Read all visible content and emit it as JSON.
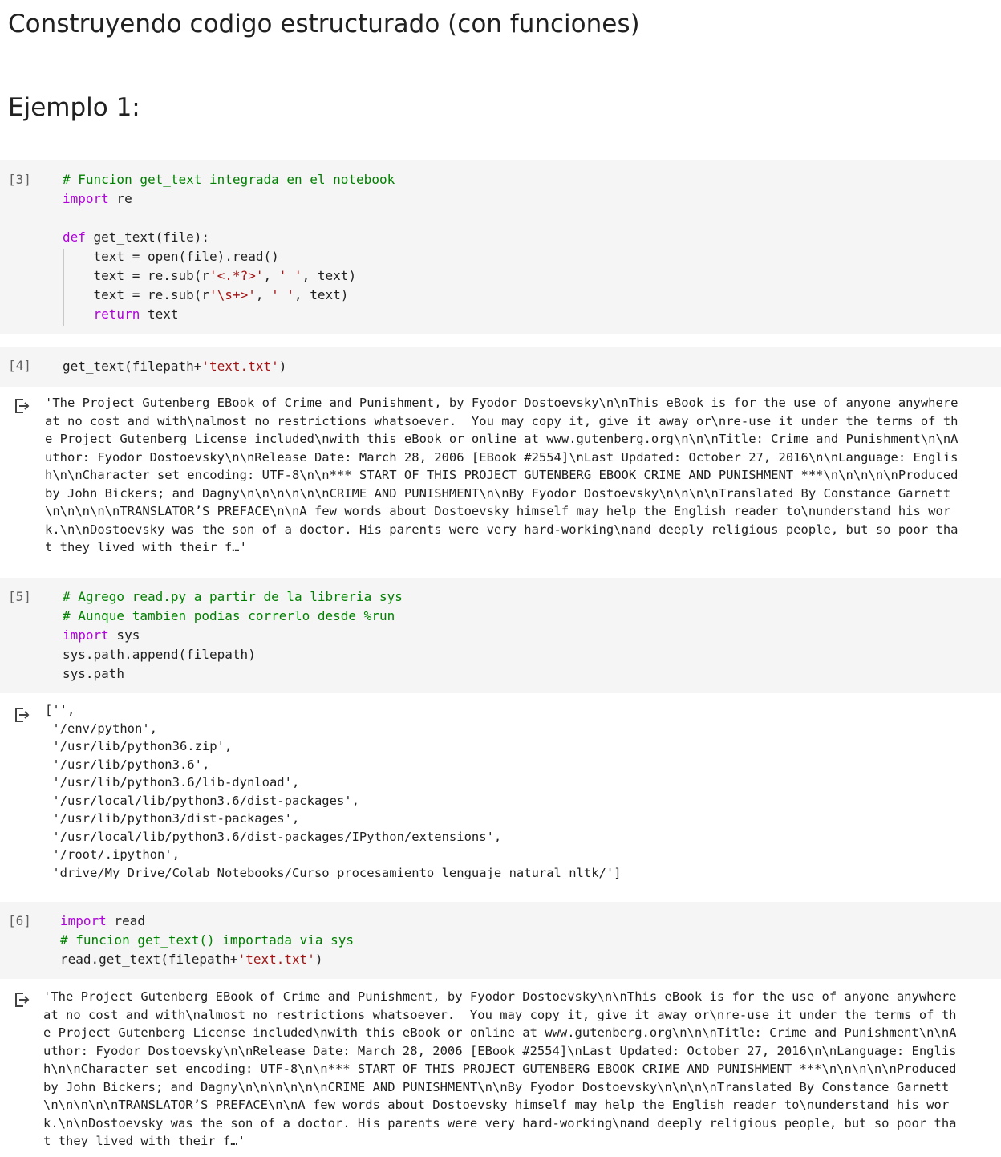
{
  "headings": {
    "title": "Construyendo codigo estructurado (con funciones)",
    "example": "Ejemplo 1:"
  },
  "cells": [
    {
      "exec_count": "[3]",
      "code_lines": [
        [
          {
            "t": "# Funcion get_text integrada en el notebook",
            "c": "cm"
          }
        ],
        [
          {
            "t": "import",
            "c": "kw"
          },
          {
            "t": " re",
            "c": ""
          }
        ],
        [
          {
            "t": "",
            "c": ""
          }
        ],
        [
          {
            "t": "def",
            "c": "kw"
          },
          {
            "t": " get_text(file):",
            "c": ""
          }
        ],
        [
          {
            "t": "    text = open(file).read()",
            "c": ""
          }
        ],
        [
          {
            "t": "    text = re.sub(r",
            "c": ""
          },
          {
            "t": "'<.*?>'",
            "c": "st"
          },
          {
            "t": ", ",
            "c": ""
          },
          {
            "t": "' '",
            "c": "st"
          },
          {
            "t": ", text)",
            "c": ""
          }
        ],
        [
          {
            "t": "    text = re.sub(r",
            "c": ""
          },
          {
            "t": "'\\s+>'",
            "c": "st"
          },
          {
            "t": ", ",
            "c": ""
          },
          {
            "t": "' '",
            "c": "st"
          },
          {
            "t": ", text)",
            "c": ""
          }
        ],
        [
          {
            "t": "    ",
            "c": ""
          },
          {
            "t": "return",
            "c": "kw"
          },
          {
            "t": " text",
            "c": ""
          }
        ]
      ]
    },
    {
      "exec_count": "[4]",
      "code_lines": [
        [
          {
            "t": "get_text(filepath+",
            "c": ""
          },
          {
            "t": "'text.txt'",
            "c": "st"
          },
          {
            "t": ")",
            "c": ""
          }
        ]
      ],
      "output_lines": [
        "'The Project Gutenberg EBook of Crime and Punishment, by Fyodor Dostoevsky\\n\\nThis eBook is for the use of anyone anywhere",
        "at no cost and with\\nalmost no restrictions whatsoever.  You may copy it, give it away or\\nre-use it under the terms of th",
        "e Project Gutenberg License included\\nwith this eBook or online at www.gutenberg.org\\n\\n\\nTitle: Crime and Punishment\\n\\nA",
        "uthor: Fyodor Dostoevsky\\n\\nRelease Date: March 28, 2006 [EBook #2554]\\nLast Updated: October 27, 2016\\n\\nLanguage: Englis",
        "h\\n\\nCharacter set encoding: UTF-8\\n\\n*** START OF THIS PROJECT GUTENBERG EBOOK CRIME AND PUNISHMENT ***\\n\\n\\n\\n\\nProduced",
        "by John Bickers; and Dagny\\n\\n\\n\\n\\n\\nCRIME AND PUNISHMENT\\n\\nBy Fyodor Dostoevsky\\n\\n\\n\\nTranslated By Constance Garnett",
        "\\n\\n\\n\\n\\nTRANSLATOR’S PREFACE\\n\\nA few words about Dostoevsky himself may help the English reader to\\nunderstand his wor",
        "k.\\n\\nDostoevsky was the son of a doctor. His parents were very hard-working\\nand deeply religious people, but so poor tha",
        "t they lived with their f…'"
      ]
    },
    {
      "exec_count": "[5]",
      "code_lines": [
        [
          {
            "t": "# Agrego read.py a partir de la libreria sys",
            "c": "cm"
          }
        ],
        [
          {
            "t": "# Aunque tambien podias correrlo desde %run",
            "c": "cm"
          }
        ],
        [
          {
            "t": "import",
            "c": "kw"
          },
          {
            "t": " sys",
            "c": ""
          }
        ],
        [
          {
            "t": "sys.path.append(filepath)",
            "c": ""
          }
        ],
        [
          {
            "t": "sys.path",
            "c": ""
          }
        ]
      ],
      "output_lines": [
        "['',",
        " '/env/python',",
        " '/usr/lib/python36.zip',",
        " '/usr/lib/python3.6',",
        " '/usr/lib/python3.6/lib-dynload',",
        " '/usr/local/lib/python3.6/dist-packages',",
        " '/usr/lib/python3/dist-packages',",
        " '/usr/local/lib/python3.6/dist-packages/IPython/extensions',",
        " '/root/.ipython',",
        " 'drive/My Drive/Colab Notebooks/Curso procesamiento lenguaje natural nltk/']"
      ]
    },
    {
      "exec_count": "[6]",
      "code_lines": [
        [
          {
            "t": "import",
            "c": "kw"
          },
          {
            "t": " read",
            "c": ""
          }
        ],
        [
          {
            "t": "# funcion get_text() importada via sys",
            "c": "cm"
          }
        ],
        [
          {
            "t": "read.get_text(filepath+",
            "c": ""
          },
          {
            "t": "'text.txt'",
            "c": "st"
          },
          {
            "t": ")",
            "c": ""
          }
        ]
      ],
      "output_lines": [
        "'The Project Gutenberg EBook of Crime and Punishment, by Fyodor Dostoevsky\\n\\nThis eBook is for the use of anyone anywhere",
        "at no cost and with\\nalmost no restrictions whatsoever.  You may copy it, give it away or\\nre-use it under the terms of th",
        "e Project Gutenberg License included\\nwith this eBook or online at www.gutenberg.org\\n\\n\\nTitle: Crime and Punishment\\n\\nA",
        "uthor: Fyodor Dostoevsky\\n\\nRelease Date: March 28, 2006 [EBook #2554]\\nLast Updated: October 27, 2016\\n\\nLanguage: Englis",
        "h\\n\\nCharacter set encoding: UTF-8\\n\\n*** START OF THIS PROJECT GUTENBERG EBOOK CRIME AND PUNISHMENT ***\\n\\n\\n\\n\\nProduced",
        "by John Bickers; and Dagny\\n\\n\\n\\n\\n\\nCRIME AND PUNISHMENT\\n\\nBy Fyodor Dostoevsky\\n\\n\\n\\nTranslated By Constance Garnett",
        "\\n\\n\\n\\n\\nTRANSLATOR’S PREFACE\\n\\nA few words about Dostoevsky himself may help the English reader to\\nunderstand his wor",
        "k.\\n\\nDostoevsky was the son of a doctor. His parents were very hard-working\\nand deeply religious people, but so poor tha",
        "t they lived with their f…'"
      ]
    }
  ],
  "colors": {
    "cell_bg": "#f5f5f5",
    "comment": "#008000",
    "keyword": "#af00db",
    "string": "#a31515",
    "exec_count": "#616161"
  },
  "icons": {
    "output": "output-arrow-icon"
  }
}
